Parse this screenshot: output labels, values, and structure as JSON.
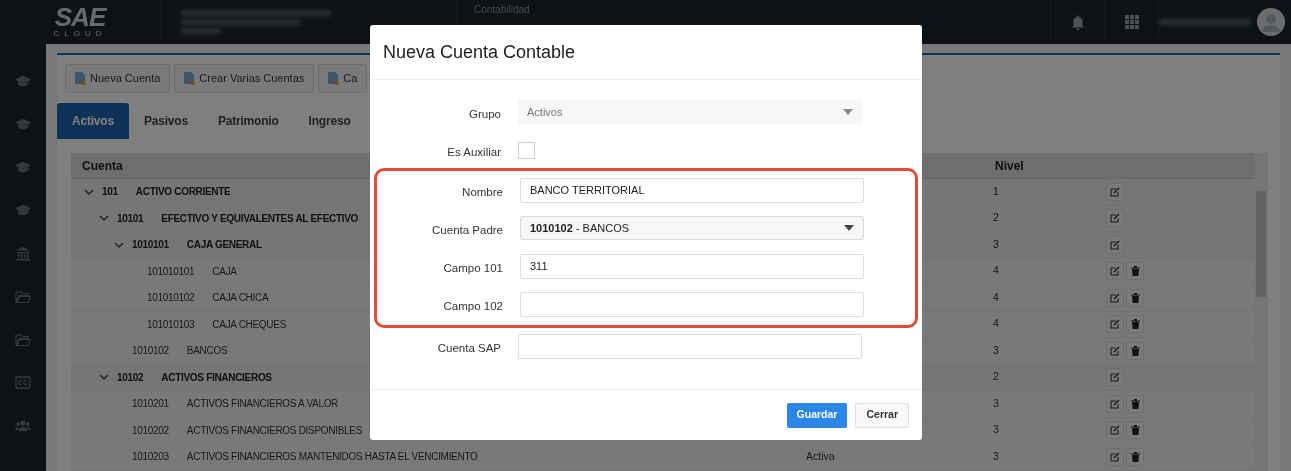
{
  "header": {
    "logo": {
      "mark": "SAE",
      "sub": "CLOUD"
    },
    "breadcrumb": {
      "section": "Contabilidad"
    }
  },
  "toolbar": [
    "Nueva Cuenta",
    "Crear Varias Cuentas",
    "Ca"
  ],
  "tabs": [
    {
      "label": "Activos",
      "selected": true
    },
    {
      "label": "Pasivos",
      "selected": false
    },
    {
      "label": "Patrimonio",
      "selected": false
    },
    {
      "label": "Ingreso",
      "selected": false
    }
  ],
  "table": {
    "columns": [
      "Cuenta",
      "Nivel"
    ],
    "rows": [
      {
        "code": "101",
        "name": "ACTIVO CORRIENTE",
        "nivel": "1",
        "deletable": false,
        "expanded": true,
        "children": [
          {
            "code": "10101",
            "name": "EFECTIVO Y EQUIVALENTES AL EFECTIVO",
            "nivel": "2",
            "deletable": false,
            "expanded": true,
            "children": [
              {
                "code": "1010101",
                "name": "CAJA GENERAL",
                "nivel": "3",
                "deletable": false,
                "expanded": true,
                "children": [
                  {
                    "code": "101010101",
                    "name": "CAJA",
                    "nivel": "4",
                    "deletable": true
                  },
                  {
                    "code": "101010102",
                    "name": "CAJA CHICA",
                    "nivel": "4",
                    "deletable": true
                  },
                  {
                    "code": "101010103",
                    "name": "CAJA CHEQUES",
                    "nivel": "4",
                    "deletable": true
                  }
                ]
              },
              {
                "code": "1010102",
                "name": "BANCOS",
                "nivel": "3",
                "deletable": true
              }
            ]
          },
          {
            "code": "10102",
            "name": "ACTIVOS FINANCIEROS",
            "nivel": "2",
            "deletable": false,
            "expanded": true,
            "children": [
              {
                "code": "1010201",
                "name": "ACTIVOS FINANCIEROS A VALOR",
                "nivel": "3",
                "deletable": true
              },
              {
                "code": "1010202",
                "name": "ACTIVOS FINANCIEROS DISPONIBLES",
                "nivel": "3",
                "deletable": true
              },
              {
                "code": "1010203",
                "name": "ACTIVOS FINANCIEROS MANTENIDOS HASTA EL VENCIMIENTO",
                "status": "Activa",
                "nivel": "3",
                "deletable": true
              }
            ]
          }
        ]
      }
    ]
  },
  "modal": {
    "title": "Nueva Cuenta Contable",
    "fields": [
      {
        "kind": "select",
        "label": "Grupo",
        "value": "Activos",
        "disabled": true,
        "highlight": false
      },
      {
        "kind": "checkbox",
        "label": "Es Auxiliar",
        "checked": false,
        "highlight": false
      },
      {
        "kind": "text",
        "label": "Nombre",
        "value": "BANCO TERRITORIAL",
        "highlight": true
      },
      {
        "kind": "select",
        "label": "Cuenta Padre",
        "value": "**1010102** - BANCOS",
        "disabled": false,
        "highlight": true
      },
      {
        "kind": "text",
        "label": "Campo 101",
        "value": "311",
        "highlight": true
      },
      {
        "kind": "text",
        "label": "Campo 102",
        "highlight": true
      },
      {
        "kind": "text",
        "label": "Cuenta SAP",
        "highlight": false
      }
    ],
    "buttons": [
      {
        "label": "Guardar",
        "kind": "primary"
      },
      {
        "label": "Cerrar",
        "kind": "default"
      }
    ]
  }
}
